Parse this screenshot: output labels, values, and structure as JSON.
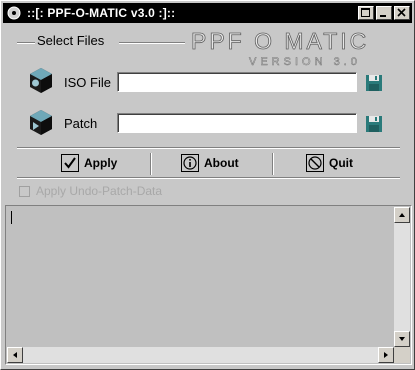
{
  "window": {
    "title": "::[: PPF-O-MATIC v3.0 :]::",
    "controls": [
      "minimize-icon",
      "maximize-icon",
      "close-icon"
    ]
  },
  "group": {
    "label": "Select Files",
    "logo_title": "PPF O MATIC",
    "logo_subtitle": "VERSION 3.0"
  },
  "iso": {
    "label": "ISO File",
    "value": "",
    "icon": "cd-drive-icon",
    "browse_icon": "floppy-disk-icon"
  },
  "patch": {
    "label": "Patch",
    "value": "",
    "icon": "patch-play-icon",
    "browse_icon": "floppy-disk-icon"
  },
  "actions": {
    "apply": "Apply",
    "about": "About",
    "quit": "Quit"
  },
  "options": {
    "undo_label": "Apply Undo-Patch-Data",
    "undo_checked": false,
    "undo_enabled": false
  },
  "log": {
    "text": ""
  },
  "colors": {
    "titlebar": "#000000",
    "face": "#c8c8c8",
    "disabled_text": "#a8a8a8"
  }
}
